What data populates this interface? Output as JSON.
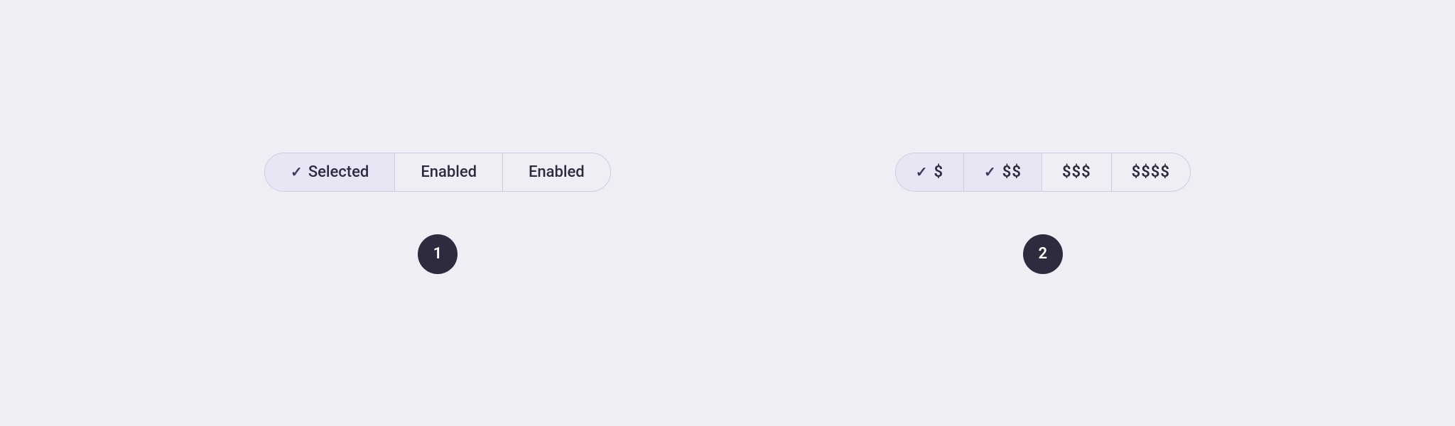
{
  "background": "#f0eef5",
  "section1": {
    "segments": [
      {
        "id": "selected",
        "label": "Selected",
        "selected": true,
        "hasCheck": true
      },
      {
        "id": "enabled1",
        "label": "Enabled",
        "selected": false,
        "hasCheck": false
      },
      {
        "id": "enabled2",
        "label": "Enabled",
        "selected": false,
        "hasCheck": false
      }
    ],
    "badge": {
      "number": "1"
    }
  },
  "section2": {
    "segments": [
      {
        "id": "dollar1",
        "label": "$",
        "selected": true,
        "hasCheck": true
      },
      {
        "id": "dollar2",
        "label": "$$",
        "selected": true,
        "hasCheck": true
      },
      {
        "id": "dollar3",
        "label": "$$$",
        "selected": false,
        "hasCheck": false
      },
      {
        "id": "dollar4",
        "label": "$$$$",
        "selected": false,
        "hasCheck": false
      }
    ],
    "badge": {
      "number": "2"
    }
  },
  "icons": {
    "check": "✓"
  }
}
